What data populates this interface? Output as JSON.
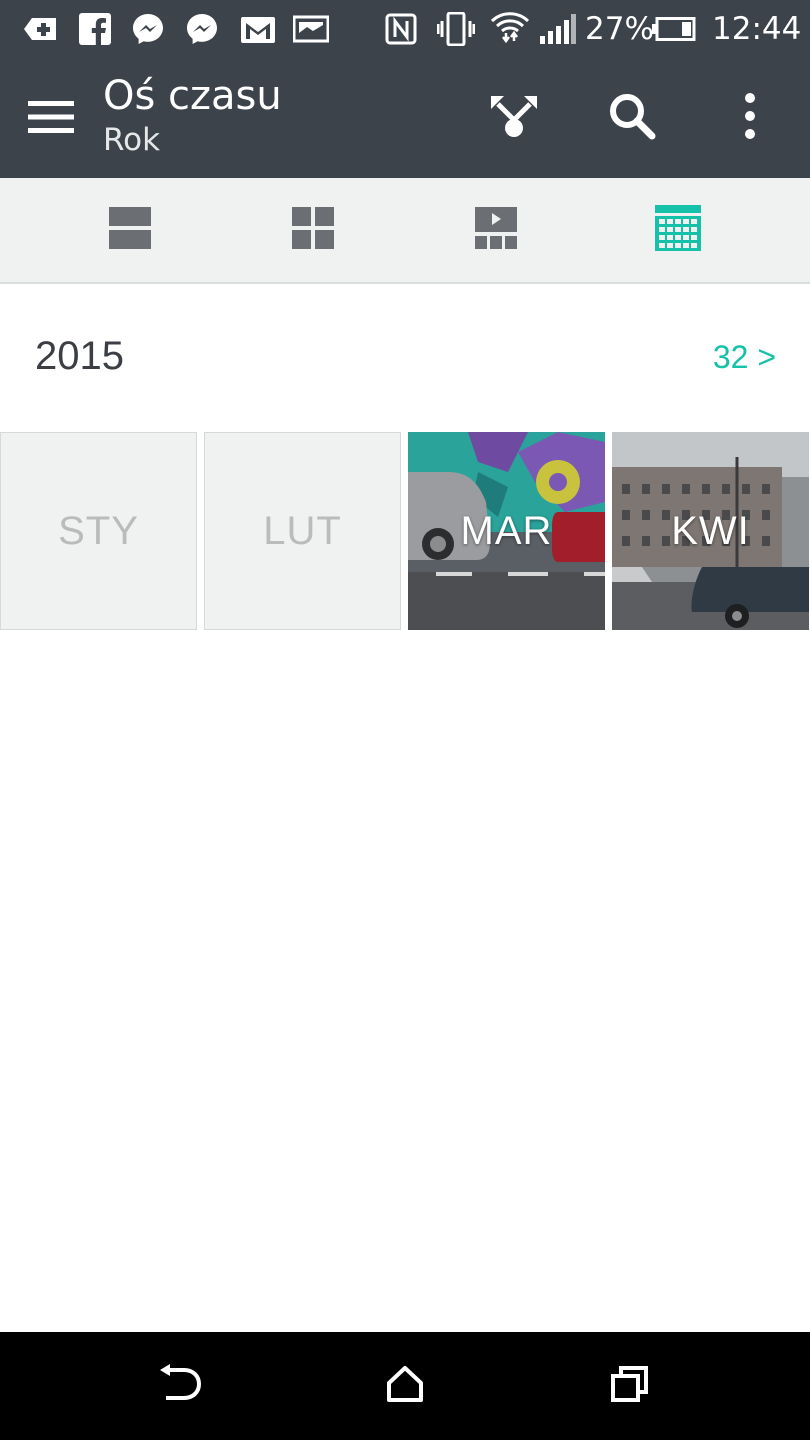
{
  "status_bar": {
    "battery_percent": "27%",
    "time": "12:44",
    "notification_icons": [
      "health-plus-icon",
      "facebook-icon",
      "messenger-icon",
      "messenger-icon",
      "gmail-icon",
      "gallery-icon"
    ],
    "system_icons": [
      "nfc-icon",
      "vibrate-icon",
      "wifi-icon",
      "signal-icon",
      "battery-icon"
    ]
  },
  "app_bar": {
    "title": "Oś czasu",
    "subtitle": "Rok",
    "actions": [
      "share-icon",
      "search-icon",
      "overflow-menu-icon"
    ]
  },
  "view_tabs": [
    {
      "icon": "list-view-icon",
      "selected": false
    },
    {
      "icon": "grid-view-icon",
      "selected": false
    },
    {
      "icon": "video-view-icon",
      "selected": false
    },
    {
      "icon": "calendar-view-icon",
      "selected": true
    }
  ],
  "colors": {
    "bar": "#3d434b",
    "accent": "#15c1a8",
    "tab_background": "#f0f2f1",
    "icon_inactive": "#6b6f73"
  },
  "year_section": {
    "year": "2015",
    "count": "32 >"
  },
  "months": [
    {
      "label": "STY",
      "has_photo": false
    },
    {
      "label": "LUT",
      "has_photo": false
    },
    {
      "label": "MAR",
      "has_photo": true
    },
    {
      "label": "KWI",
      "has_photo": true
    }
  ],
  "nav_bar": {
    "buttons": [
      "back-icon",
      "home-icon",
      "recents-icon"
    ]
  }
}
